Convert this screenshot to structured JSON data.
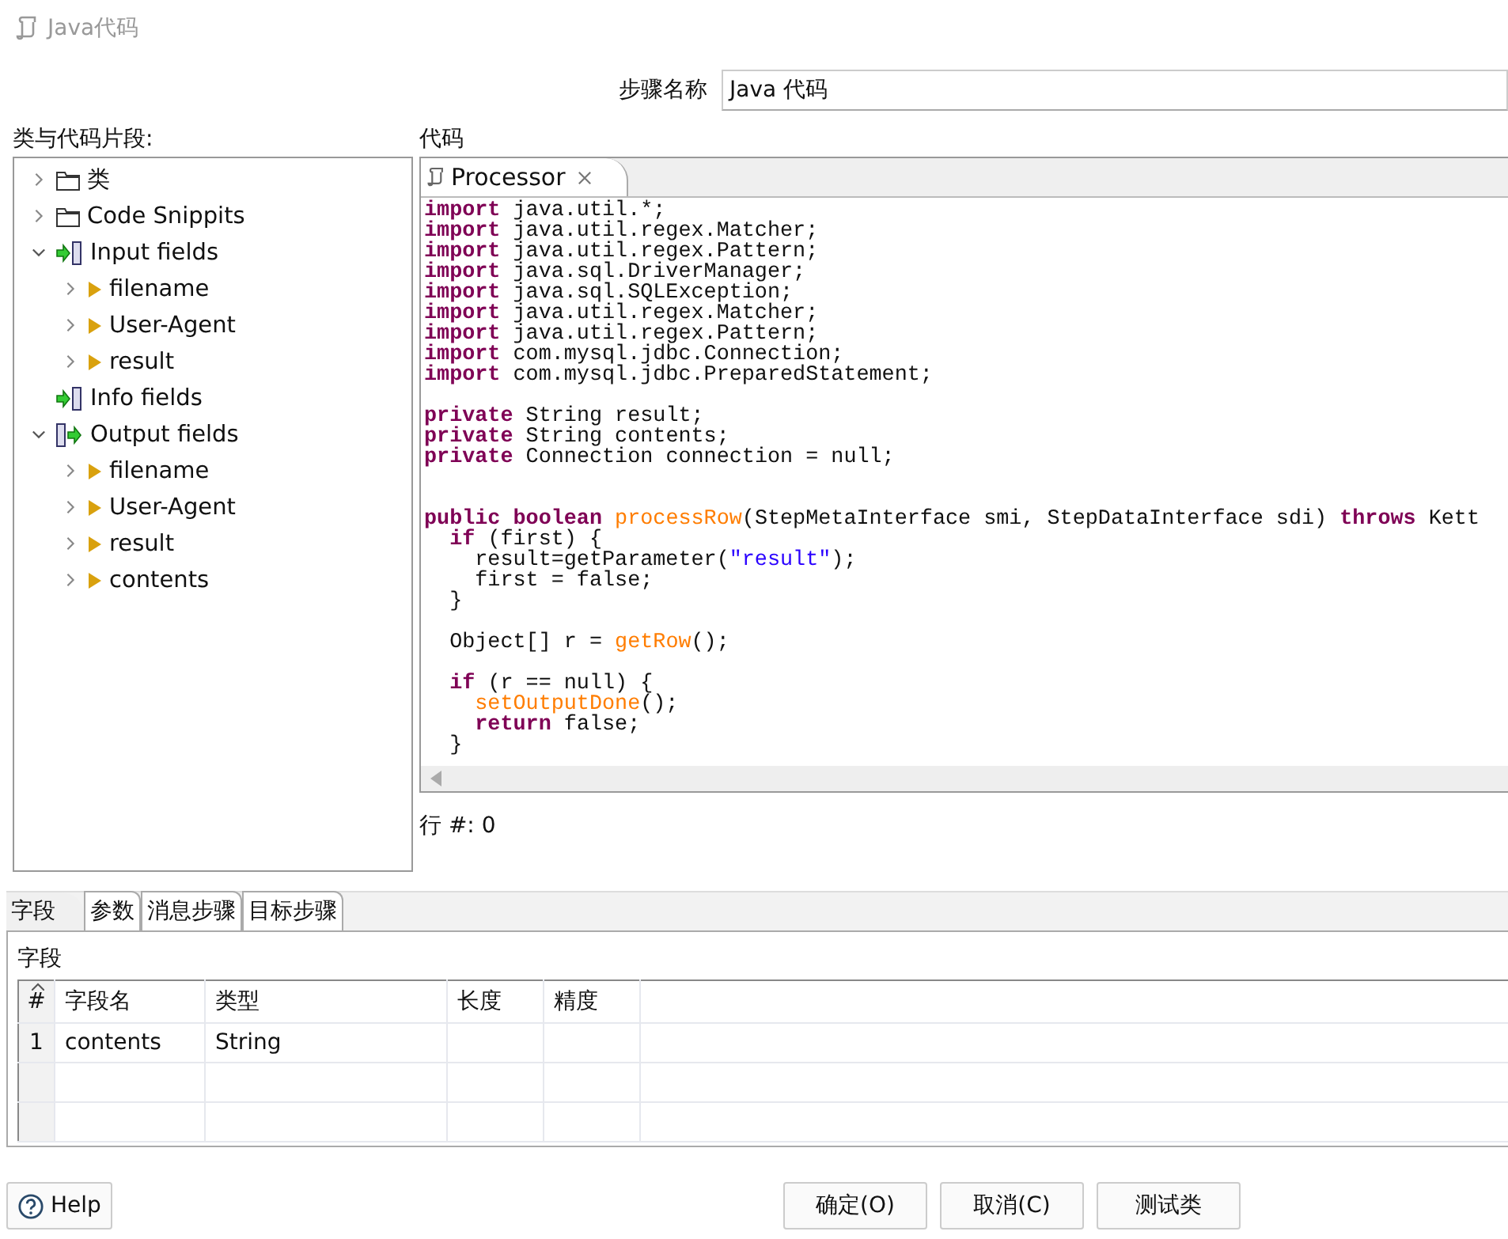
{
  "window": {
    "title": "Java代码"
  },
  "step_name": {
    "label": "步骤名称",
    "value": "Java 代码"
  },
  "tree": {
    "label": "类与代码片段:",
    "items": [
      {
        "label": "类",
        "kind": "folder",
        "expanded": false
      },
      {
        "label": "Code Snippits",
        "kind": "folder",
        "expanded": false
      },
      {
        "label": "Input fields",
        "kind": "input",
        "expanded": true,
        "children": [
          {
            "label": "filename",
            "kind": "field",
            "expanded": false
          },
          {
            "label": "User-Agent",
            "kind": "field",
            "expanded": false
          },
          {
            "label": "result",
            "kind": "field",
            "expanded": false
          }
        ]
      },
      {
        "label": "Info fields",
        "kind": "input"
      },
      {
        "label": "Output fields",
        "kind": "output",
        "expanded": true,
        "children": [
          {
            "label": "filename",
            "kind": "field",
            "expanded": false
          },
          {
            "label": "User-Agent",
            "kind": "field",
            "expanded": false
          },
          {
            "label": "result",
            "kind": "field",
            "expanded": false
          },
          {
            "label": "contents",
            "kind": "field",
            "expanded": false
          }
        ]
      }
    ]
  },
  "code": {
    "label": "代码",
    "tab": "Processor",
    "lines": [
      {
        "kind": "code",
        "segments": [
          {
            "text": "import ",
            "kind": "keyword"
          },
          {
            "text": "java.util.*;",
            "kind": "plain"
          }
        ]
      },
      {
        "kind": "code",
        "segments": [
          {
            "text": "import ",
            "kind": "keyword"
          },
          {
            "text": "java.util.regex.Matcher;",
            "kind": "plain"
          }
        ]
      },
      {
        "kind": "code",
        "segments": [
          {
            "text": "import ",
            "kind": "keyword"
          },
          {
            "text": "java.util.regex.Pattern;",
            "kind": "plain"
          }
        ]
      },
      {
        "kind": "code",
        "segments": [
          {
            "text": "import ",
            "kind": "keyword"
          },
          {
            "text": "java.sql.DriverManager;",
            "kind": "plain"
          }
        ]
      },
      {
        "kind": "code",
        "segments": [
          {
            "text": "import ",
            "kind": "keyword"
          },
          {
            "text": "java.sql.SQLException;",
            "kind": "plain"
          }
        ]
      },
      {
        "kind": "code",
        "segments": [
          {
            "text": "import ",
            "kind": "keyword"
          },
          {
            "text": "java.util.regex.Matcher;",
            "kind": "plain"
          }
        ]
      },
      {
        "kind": "code",
        "segments": [
          {
            "text": "import ",
            "kind": "keyword"
          },
          {
            "text": "java.util.regex.Pattern;",
            "kind": "plain"
          }
        ]
      },
      {
        "kind": "code",
        "segments": [
          {
            "text": "import ",
            "kind": "keyword"
          },
          {
            "text": "com.mysql.jdbc.Connection;",
            "kind": "plain"
          }
        ]
      },
      {
        "kind": "code",
        "segments": [
          {
            "text": "import ",
            "kind": "keyword"
          },
          {
            "text": "com.mysql.jdbc.PreparedStatement;",
            "kind": "plain"
          }
        ]
      },
      {
        "kind": "blank"
      },
      {
        "kind": "code",
        "segments": [
          {
            "text": "private ",
            "kind": "keyword"
          },
          {
            "text": "String result;",
            "kind": "plain"
          }
        ]
      },
      {
        "kind": "code",
        "segments": [
          {
            "text": "private ",
            "kind": "keyword"
          },
          {
            "text": "String contents;",
            "kind": "plain"
          }
        ]
      },
      {
        "kind": "code",
        "segments": [
          {
            "text": "private ",
            "kind": "keyword"
          },
          {
            "text": "Connection connection = null;",
            "kind": "plain"
          }
        ]
      },
      {
        "kind": "blank"
      },
      {
        "kind": "blank"
      },
      {
        "kind": "code",
        "segments": [
          {
            "text": "public boolean ",
            "kind": "keyword"
          },
          {
            "text": "processRow",
            "kind": "method"
          },
          {
            "text": "(StepMetaInterface smi, StepDataInterface sdi) ",
            "kind": "plain"
          },
          {
            "text": "throws ",
            "kind": "keyword"
          },
          {
            "text": "Kett",
            "kind": "plain"
          }
        ]
      },
      {
        "kind": "code",
        "segments": [
          {
            "text": "  if ",
            "kind": "keyword"
          },
          {
            "text": "(first) {",
            "kind": "plain"
          }
        ]
      },
      {
        "kind": "code",
        "segments": [
          {
            "text": "    result=getParameter(",
            "kind": "plain"
          },
          {
            "text": "\"result\"",
            "kind": "string"
          },
          {
            "text": ");",
            "kind": "plain"
          }
        ]
      },
      {
        "kind": "code",
        "segments": [
          {
            "text": "    first = false;",
            "kind": "plain"
          }
        ]
      },
      {
        "kind": "code",
        "segments": [
          {
            "text": "  }",
            "kind": "plain"
          }
        ]
      },
      {
        "kind": "blank"
      },
      {
        "kind": "code",
        "segments": [
          {
            "text": "  Object[] r = ",
            "kind": "plain"
          },
          {
            "text": "getRow",
            "kind": "method"
          },
          {
            "text": "();",
            "kind": "plain"
          }
        ]
      },
      {
        "kind": "blank"
      },
      {
        "kind": "code",
        "segments": [
          {
            "text": "  if ",
            "kind": "keyword"
          },
          {
            "text": "(r == null) {",
            "kind": "plain"
          }
        ]
      },
      {
        "kind": "code",
        "segments": [
          {
            "text": "    setOutputDone",
            "kind": "method"
          },
          {
            "text": "();",
            "kind": "plain"
          }
        ]
      },
      {
        "kind": "code",
        "segments": [
          {
            "text": "    return ",
            "kind": "keyword"
          },
          {
            "text": "false;",
            "kind": "plain"
          }
        ]
      },
      {
        "kind": "code",
        "segments": [
          {
            "text": "  }",
            "kind": "plain"
          }
        ]
      }
    ],
    "position": "行 #: 0"
  },
  "tabs": [
    {
      "label": "字段",
      "selected": true
    },
    {
      "label": "参数",
      "selected": false
    },
    {
      "label": "消息步骤",
      "selected": false
    },
    {
      "label": "目标步骤",
      "selected": false
    }
  ],
  "fields": {
    "label": "字段",
    "columns": [
      "#",
      "字段名",
      "类型",
      "长度",
      "精度"
    ],
    "rows": [
      [
        "1",
        "contents",
        "String"
      ]
    ]
  },
  "buttons": {
    "help": "Help",
    "actions": [
      "确定(O)",
      "取消(C)",
      "测试类"
    ]
  }
}
